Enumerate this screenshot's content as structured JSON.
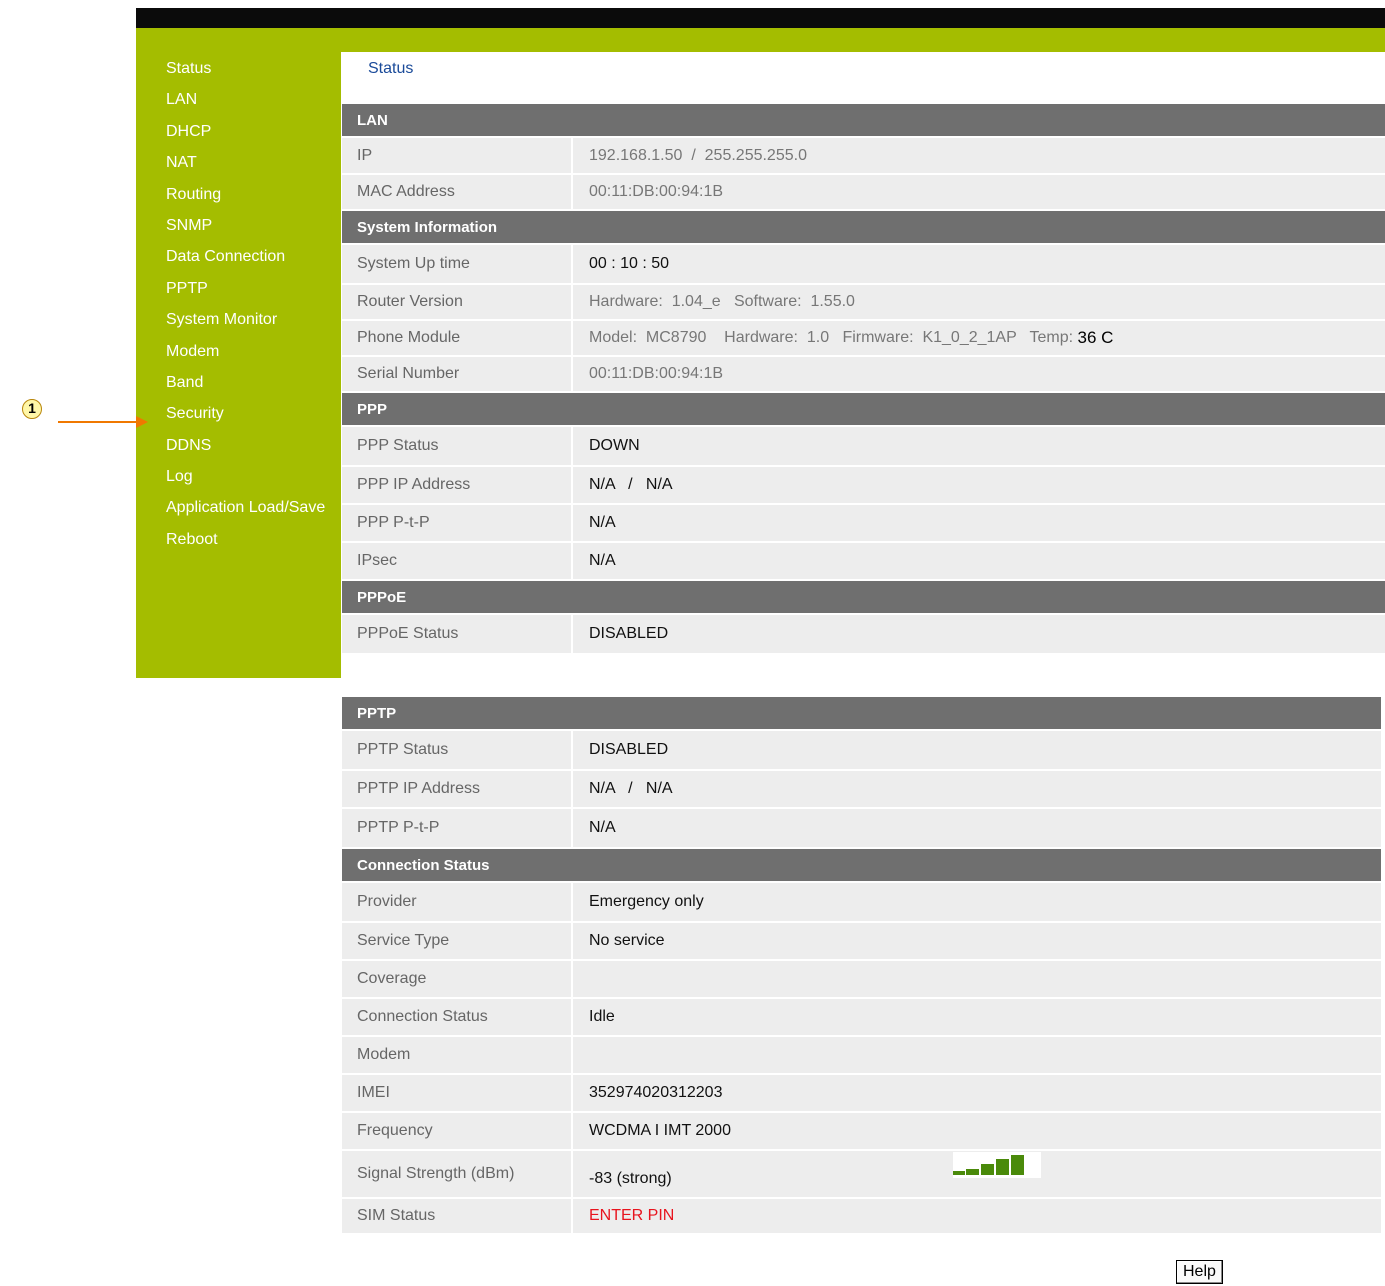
{
  "breadcrumb": "Status",
  "callout": "1",
  "sidebar": {
    "items": [
      {
        "label": "Status"
      },
      {
        "label": "LAN"
      },
      {
        "label": "DHCP"
      },
      {
        "label": "NAT"
      },
      {
        "label": "Routing"
      },
      {
        "label": "SNMP"
      },
      {
        "label": "Data Connection"
      },
      {
        "label": "PPTP"
      },
      {
        "label": "System Monitor"
      },
      {
        "label": "Modem"
      },
      {
        "label": "Band"
      },
      {
        "label": "Security"
      },
      {
        "label": "DDNS"
      },
      {
        "label": "Log"
      },
      {
        "label": "Application Load/Save"
      },
      {
        "label": "Reboot"
      }
    ]
  },
  "lan": {
    "title": "LAN",
    "ip_label": "IP",
    "ip_value": "192.168.1.50  /  255.255.255.0",
    "mac_label": "MAC Address",
    "mac_value": "00:11:DB:00:94:1B"
  },
  "system": {
    "title": "System Information",
    "uptime_label": "System Up time",
    "uptime_value": "00 : 10 : 50",
    "router_label": "Router Version",
    "router_value": "Hardware:  1.04_e   Software:  1.55.0",
    "phone_label": "Phone Module",
    "phone_value": "Model:  MC8790    Hardware:  1.0   Firmware:  K1_0_2_1AP   Temp: ",
    "phone_temp": "36 C",
    "serial_label": "Serial Number",
    "serial_value": "00:11:DB:00:94:1B"
  },
  "ppp": {
    "title": "PPP",
    "status_label": "PPP Status",
    "status_value": "DOWN",
    "ip_label": "PPP IP Address",
    "ip_value": "N/A   /   N/A",
    "ptp_label": "PPP P-t-P",
    "ptp_value": "N/A",
    "ipsec_label": "IPsec",
    "ipsec_value": "N/A"
  },
  "pppoe": {
    "title": "PPPoE",
    "status_label": "PPPoE Status",
    "status_value": "DISABLED"
  },
  "pptp": {
    "title": "PPTP",
    "status_label": "PPTP Status",
    "status_value": "DISABLED",
    "ip_label": "PPTP IP Address",
    "ip_value": "N/A   /   N/A",
    "ptp_label": "PPTP P-t-P",
    "ptp_value": "N/A"
  },
  "connection": {
    "title": "Connection Status",
    "provider_label": "Provider",
    "provider_value": "Emergency only",
    "service_label": "Service Type",
    "service_value": "No service",
    "coverage_label": "Coverage",
    "coverage_value": "",
    "conn_label": "Connection Status",
    "conn_value": "Idle",
    "modem_label": "Modem",
    "modem_value": "",
    "imei_label": "IMEI",
    "imei_value": "352974020312203",
    "freq_label": "Frequency",
    "freq_value": "WCDMA I IMT 2000",
    "signal_label": "Signal Strength (dBm)",
    "signal_value": "-83 (strong)",
    "signal_bars_lit": 5,
    "signal_bars_total": 5,
    "sim_label": "SIM Status",
    "sim_value": "ENTER PIN"
  },
  "help_label": "Help",
  "colors": {
    "accent_green": "#a4bd00",
    "section_header": "#6f6f6f",
    "warning_red": "#e8141e",
    "signal_green": "#4a8a0a",
    "callout_arrow": "#f07800"
  }
}
